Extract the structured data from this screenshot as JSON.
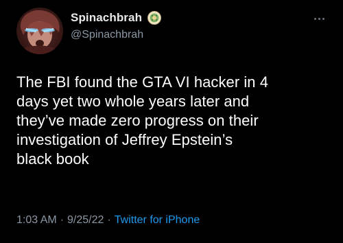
{
  "user": {
    "display_name": "Spinachbrah",
    "handle": "@Spinachbrah",
    "badge_icon": "circle-emoji-badge-icon",
    "avatar_icon": "anime-avatar-glowing-eyes"
  },
  "tweet": {
    "lines": [
      "The FBI found the GTA VI hacker in 4",
      "days yet two whole years later and",
      "they’ve made zero progress on their",
      "investigation of Jeffrey Epstein’s",
      "black book"
    ]
  },
  "meta": {
    "time": "1:03 AM",
    "separator": "·",
    "date": "9/25/22",
    "source": "Twitter for iPhone"
  },
  "colors": {
    "background": "#000000",
    "text": "#ffffff",
    "secondary": "#8b98a5",
    "link": "#1d9bf0"
  },
  "more_icon": "ellipsis-icon"
}
